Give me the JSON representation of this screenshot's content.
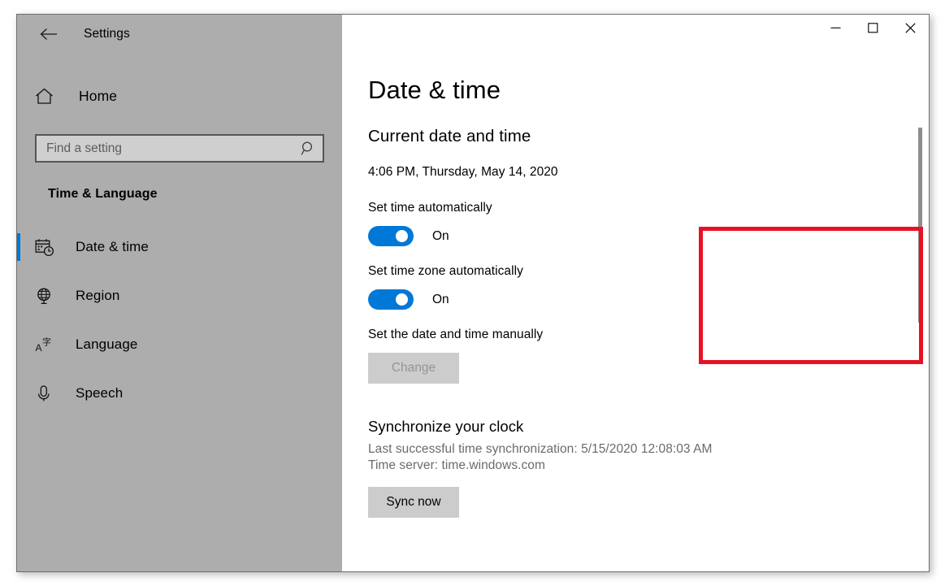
{
  "window": {
    "title": "Settings",
    "back_icon": "back-arrow-icon",
    "controls": {
      "minimize": "—",
      "maximize": "□",
      "close": "✕"
    }
  },
  "sidebar": {
    "home": {
      "label": "Home",
      "icon": "home-icon"
    },
    "search": {
      "placeholder": "Find a setting",
      "value": "",
      "icon": "search-icon"
    },
    "category": "Time & Language",
    "items": [
      {
        "label": "Date & time",
        "icon": "calendar-clock-icon",
        "selected": true
      },
      {
        "label": "Region",
        "icon": "globe-icon",
        "selected": false
      },
      {
        "label": "Language",
        "icon": "translate-icon",
        "selected": false
      },
      {
        "label": "Speech",
        "icon": "microphone-icon",
        "selected": false
      }
    ],
    "accent_color": "#0078d7",
    "background_color": "#adadad"
  },
  "main": {
    "page_title": "Date & time",
    "current_section": {
      "heading": "Current date and time",
      "value": "4:06 PM, Thursday, May 14, 2020"
    },
    "auto_time": {
      "label": "Set time automatically",
      "state": "On"
    },
    "auto_timezone": {
      "label": "Set time zone automatically",
      "state": "On"
    },
    "manual": {
      "label": "Set the date and time manually",
      "button": "Change",
      "button_disabled": true
    },
    "sync": {
      "heading": "Synchronize your clock",
      "last_sync": "Last successful time synchronization: 5/15/2020 12:08:03 AM",
      "time_server": "Time server: time.windows.com",
      "button": "Sync now"
    }
  },
  "highlight": {
    "color": "#e81123"
  }
}
